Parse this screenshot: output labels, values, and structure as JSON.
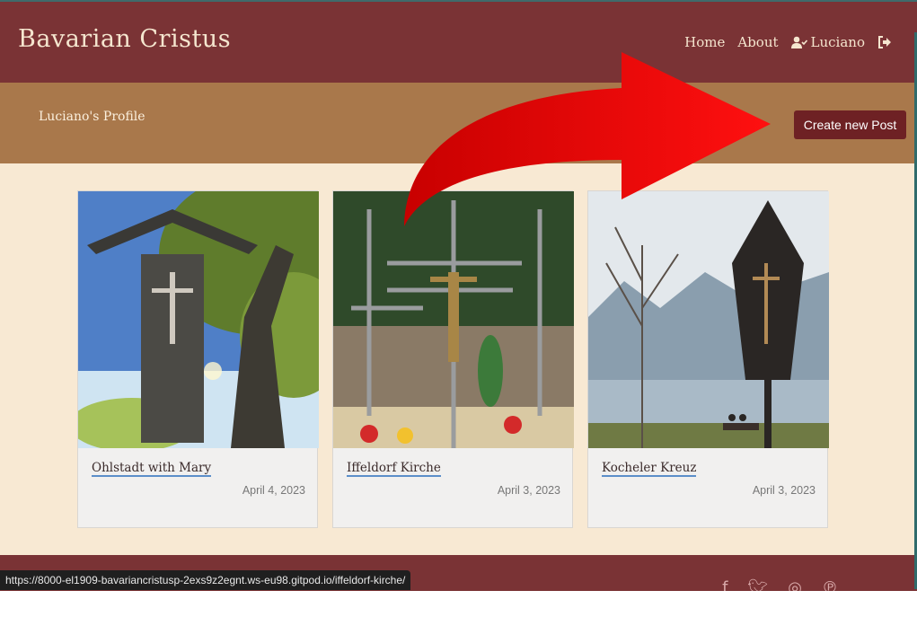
{
  "navbar": {
    "brand": "Bavarian Cristus",
    "links": {
      "home": "Home",
      "about": "About",
      "user": "Luciano"
    }
  },
  "profile": {
    "title": "Luciano's Profile",
    "create_button": "Create new Post"
  },
  "posts": [
    {
      "title": "Ohlstadt with Mary",
      "date": "April 4, 2023"
    },
    {
      "title": "Iffeldorf Kirche",
      "date": "April 3, 2023"
    },
    {
      "title": "Kocheler Kreuz",
      "date": "April 3, 2023"
    }
  ],
  "footer": {
    "social_icons": [
      "facebook-icon",
      "twitter-icon",
      "instagram-icon",
      "pinterest-icon"
    ]
  },
  "status_bar": {
    "url": "https://8000-el1909-bavariancristusp-2exs9z2egnt.ws-eu98.gitpod.io/iffeldorf-kirche/"
  },
  "colors": {
    "navbar": "#7a3335",
    "profile_band": "#a9784b",
    "content_bg": "#f8e9d3",
    "button": "#6e2124",
    "annotation_arrow": "#e00000"
  }
}
